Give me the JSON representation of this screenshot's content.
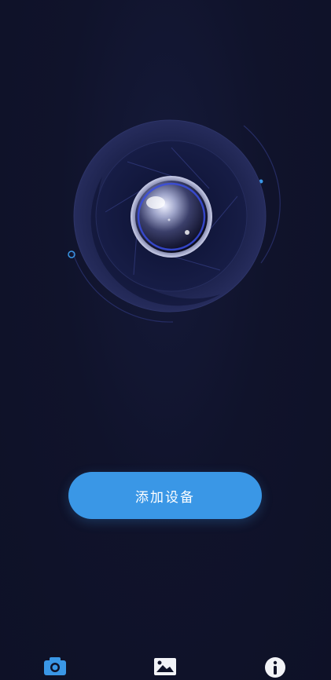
{
  "main": {
    "add_device_label": "添加设备"
  },
  "tabbar": {
    "items": [
      {
        "icon": "camera-icon",
        "active": true
      },
      {
        "icon": "gallery-icon",
        "active": false
      },
      {
        "icon": "info-icon",
        "active": false
      }
    ]
  },
  "colors": {
    "background": "#0f1228",
    "accent": "#3a97e6",
    "icon_inactive": "#f2f3f7"
  }
}
